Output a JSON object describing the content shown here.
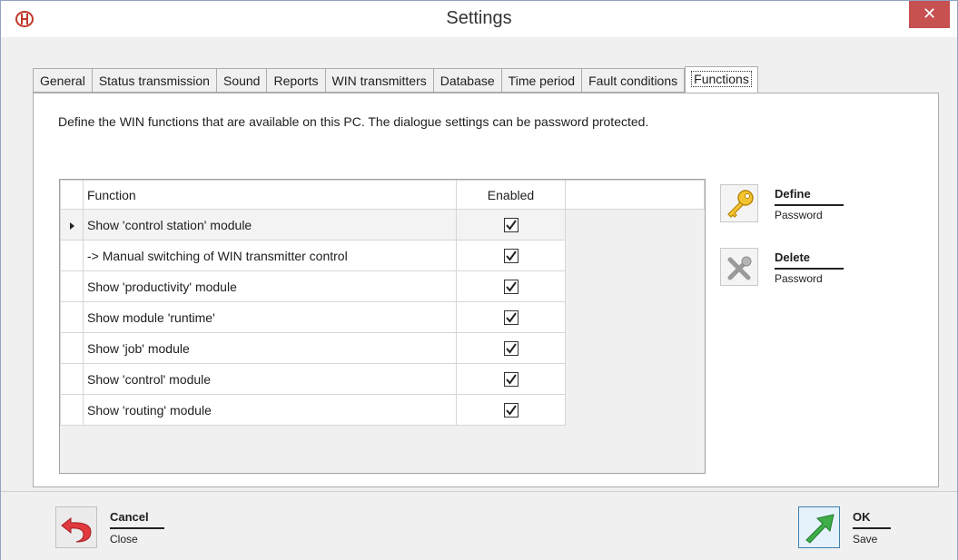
{
  "window": {
    "title": "Settings",
    "close_glyph": "✕",
    "accent_close": "#c75050"
  },
  "tabs": [
    {
      "label": "General"
    },
    {
      "label": "Status transmission"
    },
    {
      "label": "Sound"
    },
    {
      "label": "Reports"
    },
    {
      "label": "WIN transmitters"
    },
    {
      "label": "Database"
    },
    {
      "label": "Time period"
    },
    {
      "label": "Fault conditions"
    },
    {
      "label": "Functions",
      "active": true
    }
  ],
  "panel": {
    "description": "Define the WIN functions that are available on this PC. The dialogue settings can be password protected."
  },
  "grid": {
    "columns": {
      "function": "Function",
      "enabled": "Enabled"
    },
    "rows": [
      {
        "function": "Show 'control station' module",
        "enabled": true,
        "selected": true
      },
      {
        "function": "-> Manual switching of WIN transmitter control",
        "enabled": true
      },
      {
        "function": "Show 'productivity' module",
        "enabled": true
      },
      {
        "function": "Show module 'runtime'",
        "enabled": true
      },
      {
        "function": "Show 'job' module",
        "enabled": true
      },
      {
        "function": "Show 'control' module",
        "enabled": true
      },
      {
        "function": "Show 'routing' module",
        "enabled": true
      }
    ]
  },
  "side_buttons": {
    "define": {
      "label": "Define",
      "sub": "Password",
      "icon": "key-icon"
    },
    "delete": {
      "label": "Delete",
      "sub": "Password",
      "icon": "delete-key-icon"
    }
  },
  "bottom": {
    "cancel": {
      "label": "Cancel",
      "sub": "Close",
      "icon": "undo-arrow-icon"
    },
    "ok": {
      "label": "OK",
      "sub": "Save",
      "icon": "check-arrow-icon"
    }
  }
}
